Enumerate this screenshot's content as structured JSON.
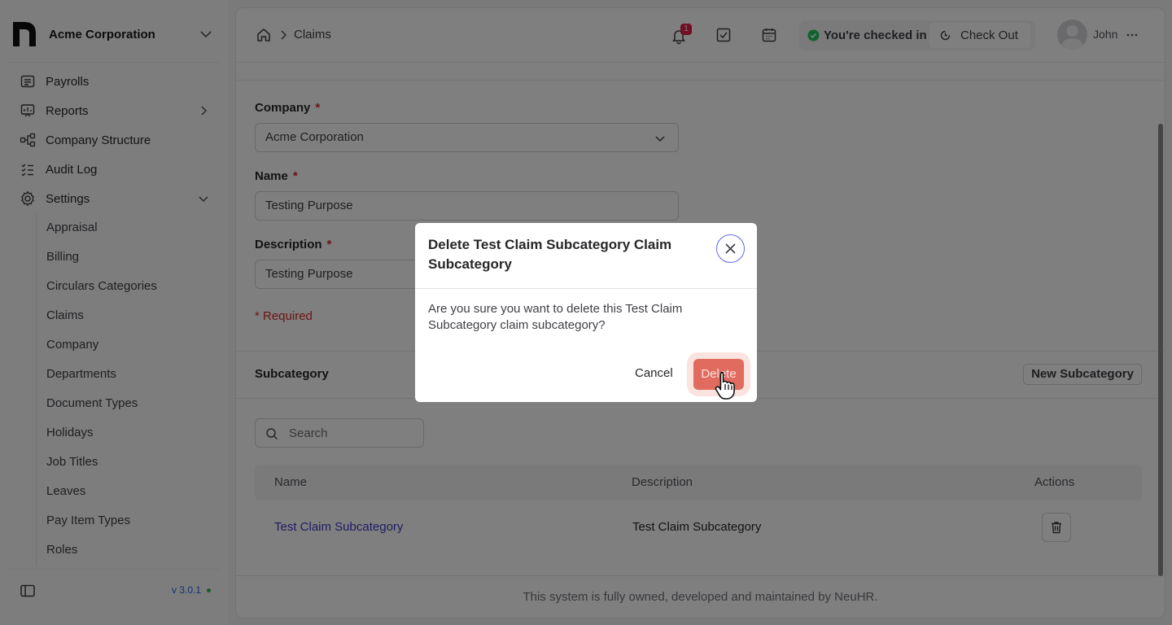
{
  "brand": {
    "company": "Acme Corporation"
  },
  "sidebar": {
    "items": [
      {
        "label": "Payrolls",
        "icon": "receipt-icon"
      },
      {
        "label": "Reports",
        "icon": "presentation-chart-icon"
      },
      {
        "label": "Company Structure",
        "icon": "hierarchy-icon"
      },
      {
        "label": "Audit Log",
        "icon": "list-check-icon"
      },
      {
        "label": "Settings",
        "icon": "gear-icon"
      }
    ],
    "settings_items": [
      "Appraisal",
      "Billing",
      "Circulars Categories",
      "Claims",
      "Company",
      "Departments",
      "Document Types",
      "Holidays",
      "Job Titles",
      "Leaves",
      "Pay Item Types",
      "Roles"
    ],
    "version": "v 3.0.1"
  },
  "topbar": {
    "breadcrumb": "Claims",
    "notification_count": "1",
    "checkin_status": "You're checked in",
    "checkout_label": "Check Out",
    "user_name": "John"
  },
  "form": {
    "company_label": "Company",
    "company_value": "Acme Corporation",
    "name_label": "Name",
    "name_value": "Testing Purpose",
    "description_label": "Description",
    "description_value": "Testing Purpose",
    "required_marker": "*",
    "required_note": "* Required"
  },
  "subcategory": {
    "title": "Subcategory",
    "new_button": "New Subcategory",
    "search_placeholder": "Search",
    "columns": [
      "Name",
      "Description",
      "Actions"
    ],
    "rows": [
      {
        "name": "Test Claim Subcategory",
        "description": "Test Claim Subcategory"
      }
    ]
  },
  "footer": "This system is fully owned, developed and maintained by NeuHR.",
  "modal": {
    "title": "Delete Test Claim Subcategory Claim Subcategory",
    "body": "Are you sure you want to delete this Test Claim Subcategory claim subcategory?",
    "cancel": "Cancel",
    "delete": "Delete"
  },
  "colors": {
    "accent": "#4338ca",
    "danger": "#dc2626",
    "delete_button": "#e26b5f",
    "success": "#22c55e"
  }
}
